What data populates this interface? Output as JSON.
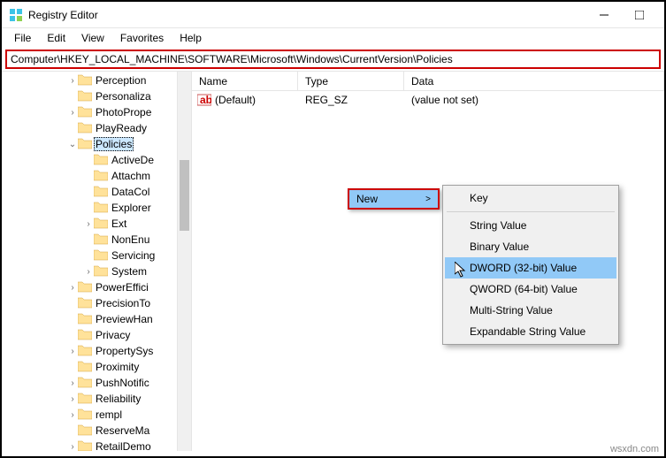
{
  "window": {
    "title": "Registry Editor"
  },
  "menubar": {
    "file": "File",
    "edit": "Edit",
    "view": "View",
    "favorites": "Favorites",
    "help": "Help"
  },
  "address": "Computer\\HKEY_LOCAL_MACHINE\\SOFTWARE\\Microsoft\\Windows\\CurrentVersion\\Policies",
  "tree": {
    "items": [
      {
        "label": "Perception",
        "depth": 3,
        "chev": ">"
      },
      {
        "label": "Personaliza",
        "depth": 3,
        "chev": ""
      },
      {
        "label": "PhotoPrope",
        "depth": 3,
        "chev": ">"
      },
      {
        "label": "PlayReady",
        "depth": 3,
        "chev": ""
      },
      {
        "label": "Policies",
        "depth": 3,
        "chev": "v",
        "selected": true
      },
      {
        "label": "ActiveDe",
        "depth": 4,
        "chev": ""
      },
      {
        "label": "Attachm",
        "depth": 4,
        "chev": ""
      },
      {
        "label": "DataCol",
        "depth": 4,
        "chev": ""
      },
      {
        "label": "Explorer",
        "depth": 4,
        "chev": ""
      },
      {
        "label": "Ext",
        "depth": 4,
        "chev": ">"
      },
      {
        "label": "NonEnu",
        "depth": 4,
        "chev": ""
      },
      {
        "label": "Servicing",
        "depth": 4,
        "chev": ""
      },
      {
        "label": "System",
        "depth": 4,
        "chev": ">"
      },
      {
        "label": "PowerEffici",
        "depth": 3,
        "chev": ">"
      },
      {
        "label": "PrecisionTo",
        "depth": 3,
        "chev": ""
      },
      {
        "label": "PreviewHan",
        "depth": 3,
        "chev": ""
      },
      {
        "label": "Privacy",
        "depth": 3,
        "chev": ""
      },
      {
        "label": "PropertySys",
        "depth": 3,
        "chev": ">"
      },
      {
        "label": "Proximity",
        "depth": 3,
        "chev": ""
      },
      {
        "label": "PushNotific",
        "depth": 3,
        "chev": ">"
      },
      {
        "label": "Reliability",
        "depth": 3,
        "chev": ">"
      },
      {
        "label": "rempl",
        "depth": 3,
        "chev": ">"
      },
      {
        "label": "ReserveMa",
        "depth": 3,
        "chev": ""
      },
      {
        "label": "RetailDemo",
        "depth": 3,
        "chev": ">"
      }
    ]
  },
  "list": {
    "headers": {
      "name": "Name",
      "type": "Type",
      "data": "Data"
    },
    "rows": [
      {
        "name": "(Default)",
        "type": "REG_SZ",
        "data": "(value not set)"
      }
    ]
  },
  "ctx_new": {
    "label": "New",
    "arrow": ">"
  },
  "ctx_menu": {
    "items": [
      "Key",
      "String Value",
      "Binary Value",
      "DWORD (32-bit) Value",
      "QWORD (64-bit) Value",
      "Multi-String Value",
      "Expandable String Value"
    ],
    "highlighted_index": 3
  },
  "watermark": "wsxdn.com"
}
